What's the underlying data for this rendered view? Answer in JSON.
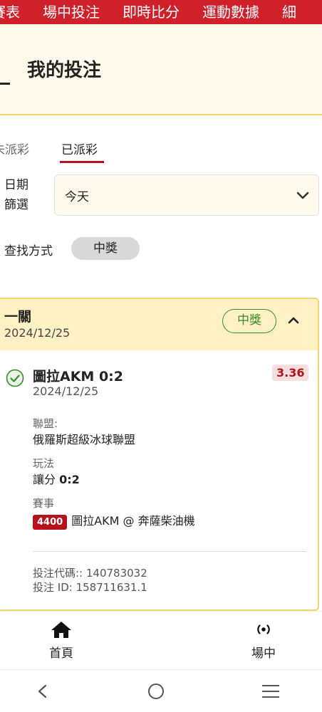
{
  "topnav": {
    "tabs": [
      "賽表",
      "場中投注",
      "即時比分",
      "運動數據",
      "細"
    ]
  },
  "header": {
    "title": "我的投注"
  },
  "bet_tabs": [
    {
      "label": "未派彩",
      "active": false
    },
    {
      "label": "已派彩",
      "active": true
    }
  ],
  "filter": {
    "label_line1": "日期",
    "label_line2": "篩選",
    "value": "今天"
  },
  "search": {
    "label": "查找方式",
    "chip": "中獎"
  },
  "bet_card": {
    "type": "一關",
    "date": "2024/12/25",
    "status": "中獎",
    "selection": {
      "title": "圖拉AKM 0:2",
      "date": "2024/12/25",
      "odds": "3.36",
      "league_label": "聯盟:",
      "league": "俄羅斯超級冰球聯盟",
      "market_label": "玩法",
      "market_prefix": "讓分",
      "market_value": "0:2",
      "event_label": "賽事",
      "event_id": "4400",
      "event": "圖拉AKM @ 奔薩柴油機"
    },
    "bet_code": "投注代碼:: 140783032",
    "bet_id": "投注 ID: 158711631.1"
  },
  "bottom_nav": {
    "home": "首頁",
    "live": "場中"
  },
  "colors": {
    "brand_red": "#d0202a",
    "accent_yellow": "#f0d66a",
    "win_green": "#3a8b2a"
  }
}
